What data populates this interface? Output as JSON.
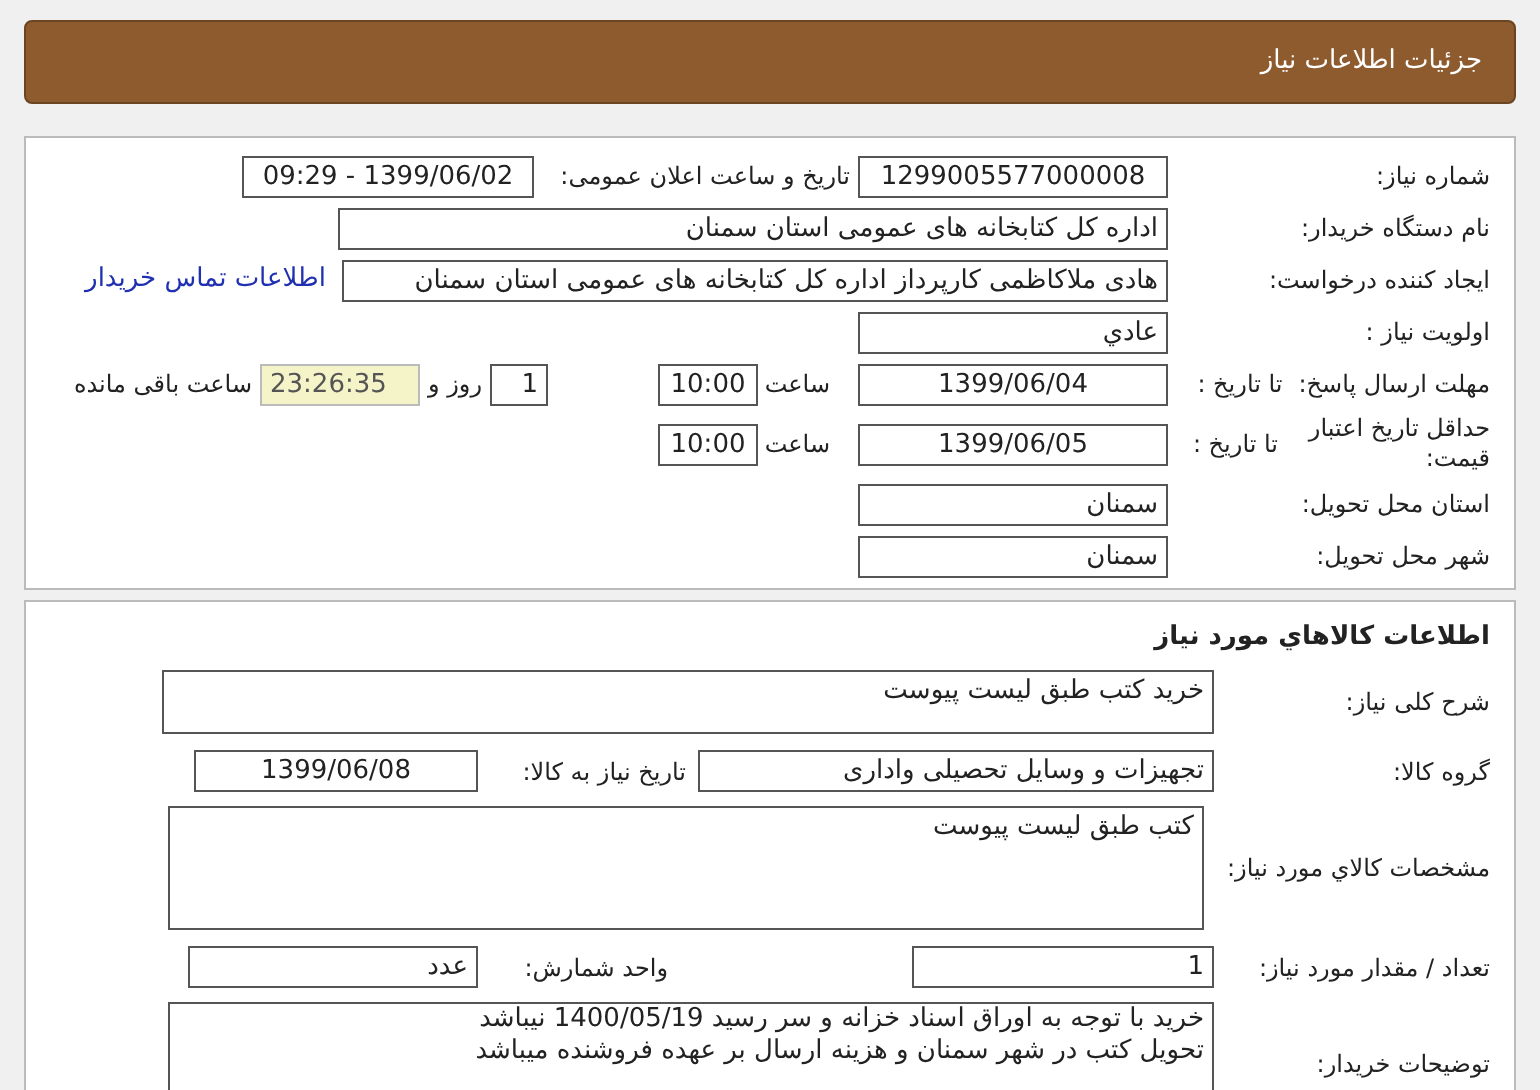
{
  "header": {
    "title": "جزئیات اطلاعات نیاز"
  },
  "need_info": {
    "need_number": {
      "label": "شماره نیاز:",
      "value": "1299005577000008"
    },
    "announce": {
      "label": "تاریخ و ساعت اعلان عمومی:",
      "value": "1399/06/02 - 09:29"
    },
    "buyer_org": {
      "label": "نام دستگاه خریدار:",
      "value": "اداره کل کتابخانه های عمومی استان سمنان"
    },
    "requester": {
      "label": "ایجاد کننده درخواست:",
      "value": "هادی ملاکاظمی کارپرداز اداره کل کتابخانه های عمومی استان سمنان",
      "link": "اطلاعات تماس خریدار"
    },
    "priority": {
      "label": "اولویت نیاز :",
      "value": "عادي"
    },
    "deadline": {
      "label": "مهلت ارسال پاسخ:",
      "sublabel": "تا تاریخ :",
      "date": "1399/06/04",
      "time_label": "ساعت",
      "time": "10:00",
      "days": "1",
      "days_label": "روز و",
      "remaining": "23:26:35",
      "remaining_label": "ساعت باقی مانده"
    },
    "validity": {
      "label": "حداقل تاریخ اعتبار قیمت:",
      "sublabel": "تا تاریخ :",
      "date": "1399/06/05",
      "time_label": "ساعت",
      "time": "10:00"
    },
    "province": {
      "label": "استان محل تحویل:",
      "value": "سمنان"
    },
    "city": {
      "label": "شهر محل تحویل:",
      "value": "سمنان"
    }
  },
  "goods": {
    "title": "اطلاعات کالاهاي مورد نياز",
    "summary": {
      "label": "شرح کلی نیاز:",
      "value": "خرید کتب طبق لیست پیوست"
    },
    "group": {
      "label": "گروه کالا:",
      "value": "تجهیزات و وسایل تحصیلی واداری",
      "date_label": "تاریخ نیاز به کالا:",
      "date": "1399/06/08"
    },
    "specs": {
      "label": "مشخصات کالاي مورد نياز:",
      "value": "کتب طبق لیست پیوست"
    },
    "quantity": {
      "label": "تعداد / مقدار مورد نیاز:",
      "value": "1",
      "unit_label": "واحد شمارش:",
      "unit": "عدد"
    },
    "notes": {
      "label": "توضیحات خریدار:",
      "lines": [
        "خرید با توجه به اوراق اسناد خزانه و سر رسید 1400/05/19 نیباشد",
        "تحویل کتب در شهر سمنان و هزینه ارسال بر عهده فروشنده میباشد"
      ]
    }
  }
}
